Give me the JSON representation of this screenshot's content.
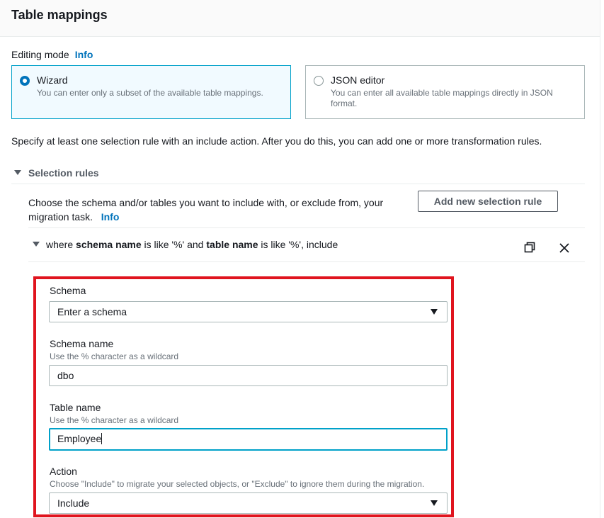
{
  "header": {
    "title": "Table mappings"
  },
  "editing_mode": {
    "label": "Editing mode",
    "info": "Info",
    "options": [
      {
        "title": "Wizard",
        "description": "You can enter only a subset of the available table mappings.",
        "selected": true
      },
      {
        "title": "JSON editor",
        "description": "You can enter all available table mappings directly in JSON format.",
        "selected": false
      }
    ]
  },
  "instruction": "Specify at least one selection rule with an include action. After you do this, you can add one or more transformation rules.",
  "selection_rules": {
    "title": "Selection rules",
    "description": "Choose the schema and/or tables you want to include with, or exclude from, your migration task.",
    "info": "Info",
    "add_button": "Add new selection rule",
    "rule": {
      "prefix": "where",
      "schema_key": "schema name",
      "is_like_1": "is like '%' and",
      "table_key": "table name",
      "is_like_2": "is like '%', include"
    },
    "form": {
      "schema": {
        "label": "Schema",
        "value": "Enter a schema"
      },
      "schema_name": {
        "label": "Schema name",
        "description": "Use the % character as a wildcard",
        "value": "dbo"
      },
      "table_name": {
        "label": "Table name",
        "description": "Use the % character as a wildcard",
        "value": "Employee"
      },
      "action": {
        "label": "Action",
        "description": "Choose \"Include\" to migrate your selected objects, or \"Exclude\" to ignore them during the migration.",
        "value": "Include"
      }
    }
  },
  "colors": {
    "accent": "#0073bb",
    "focus": "#00a1c9",
    "highlight": "#e0141e"
  }
}
